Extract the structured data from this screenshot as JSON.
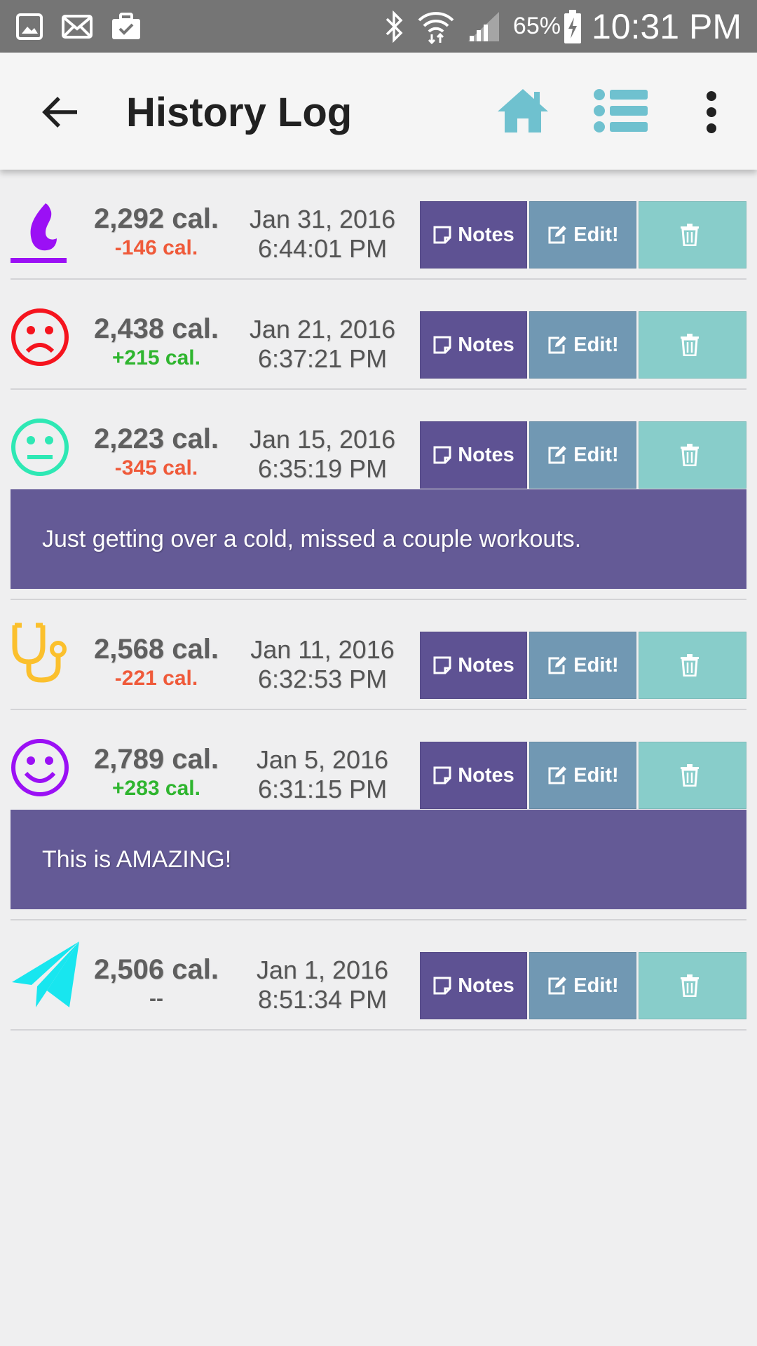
{
  "status_bar": {
    "battery_pct": "65%",
    "time": "10:31 PM"
  },
  "header": {
    "title": "History Log",
    "icons": [
      "back-arrow-icon",
      "home-icon",
      "list-icon",
      "more-vert-icon"
    ],
    "accent": "#6fc1cf"
  },
  "buttons": {
    "notes": "Notes",
    "edit": "Edit!"
  },
  "colors": {
    "notes_bg": "#5e5293",
    "edit_bg": "#7198b3",
    "delete_bg": "#88cdca",
    "note_panel_bg": "#645a96",
    "negative": "#ef5a3a",
    "positive": "#2fb52f"
  },
  "entries": [
    {
      "icon": "flame-icon",
      "calories": "2,292 cal.",
      "delta": "-146 cal.",
      "date": "Jan 31, 2016",
      "time": "6:44:01 PM"
    },
    {
      "icon": "sad-face-icon",
      "calories": "2,438 cal.",
      "delta": "+215 cal.",
      "date": "Jan 21, 2016",
      "time": "6:37:21 PM"
    },
    {
      "icon": "neutral-face-icon",
      "calories": "2,223 cal.",
      "delta": "-345 cal.",
      "date": "Jan 15, 2016",
      "time": "6:35:19 PM",
      "note": "Just getting over a cold, missed a couple workouts."
    },
    {
      "icon": "stethoscope-icon",
      "calories": "2,568 cal.",
      "delta": "-221 cal.",
      "date": "Jan 11, 2016",
      "time": "6:32:53 PM"
    },
    {
      "icon": "happy-face-icon",
      "calories": "2,789 cal.",
      "delta": "+283 cal.",
      "date": "Jan 5, 2016",
      "time": "6:31:15 PM",
      "note": "This is AMAZING!"
    },
    {
      "icon": "paper-plane-icon",
      "calories": "2,506 cal.",
      "delta": "--",
      "date": "Jan 1, 2016",
      "time": "8:51:34 PM"
    }
  ]
}
